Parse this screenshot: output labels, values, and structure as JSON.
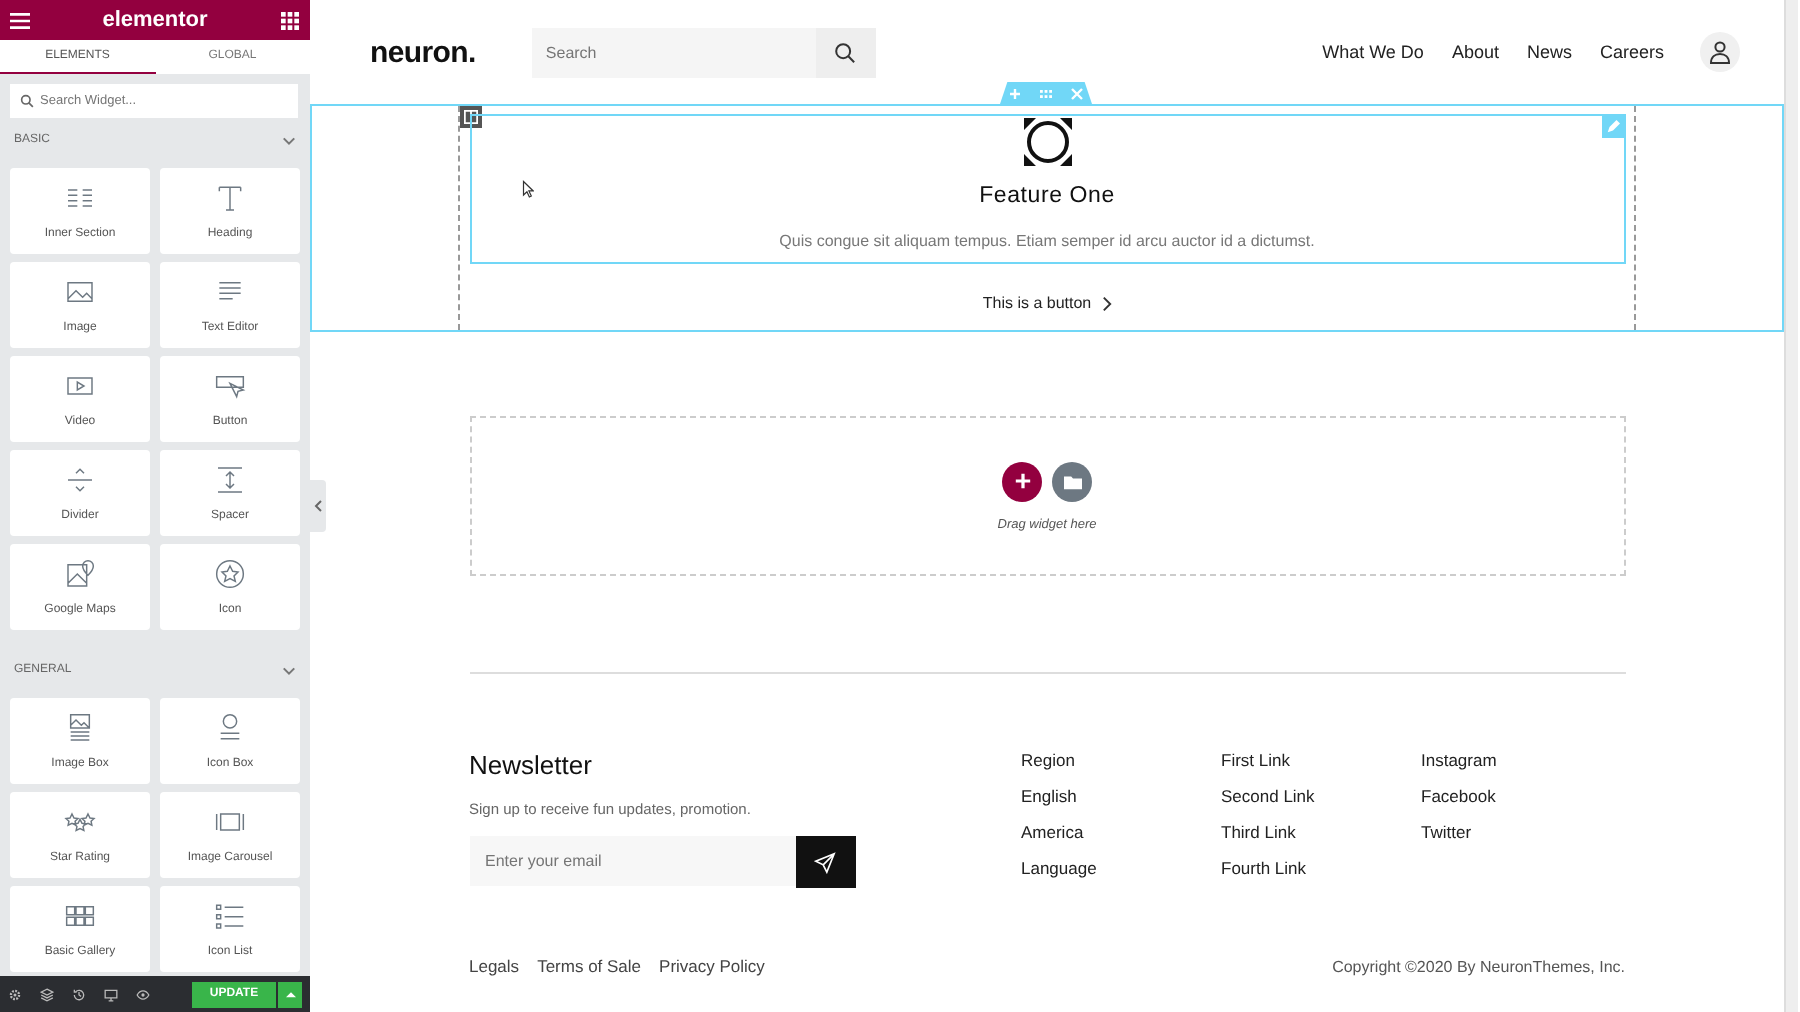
{
  "sidebar": {
    "title": "elementor",
    "tabs": [
      {
        "label": "ELEMENTS",
        "selected": true
      },
      {
        "label": "GLOBAL",
        "selected": false
      }
    ],
    "search": {
      "placeholder": "Search Widget..."
    },
    "categories": [
      {
        "name": "BASIC",
        "expanded": true,
        "widgets": [
          "Inner Section",
          "Heading",
          "Image",
          "Text Editor",
          "Video",
          "Button",
          "Divider",
          "Spacer",
          "Google Maps",
          "Icon"
        ]
      },
      {
        "name": "GENERAL",
        "expanded": true,
        "widgets": [
          "Image Box",
          "Icon Box",
          "Star Rating",
          "Image Carousel",
          "Basic Gallery",
          "Icon List"
        ]
      }
    ],
    "update_button": "UPDATE"
  },
  "header": {
    "logo": "neuron.",
    "search": {
      "placeholder": "Search"
    },
    "nav": [
      "What We Do",
      "About",
      "News",
      "Careers"
    ]
  },
  "feature": {
    "title": "Feature One",
    "text": "Quis congue sit aliquam tempus. Etiam semper id arcu auctor id a dictumst.",
    "button": "This is a button"
  },
  "drop_zone": {
    "hint": "Drag widget here"
  },
  "footer": {
    "newsletter": {
      "title": "Newsletter",
      "text": "Sign up to receive fun updates, promotion.",
      "placeholder": "Enter your email"
    },
    "columns": [
      [
        "Region",
        "English",
        "America",
        "Language"
      ],
      [
        "First Link",
        "Second Link",
        "Third Link",
        "Fourth Link"
      ],
      [
        "Instagram",
        "Facebook",
        "Twitter"
      ]
    ],
    "legal_links": [
      "Legals",
      "Terms of Sale",
      "Privacy Policy"
    ],
    "copyright": "Copyright ©2020 By NeuronThemes, Inc."
  }
}
